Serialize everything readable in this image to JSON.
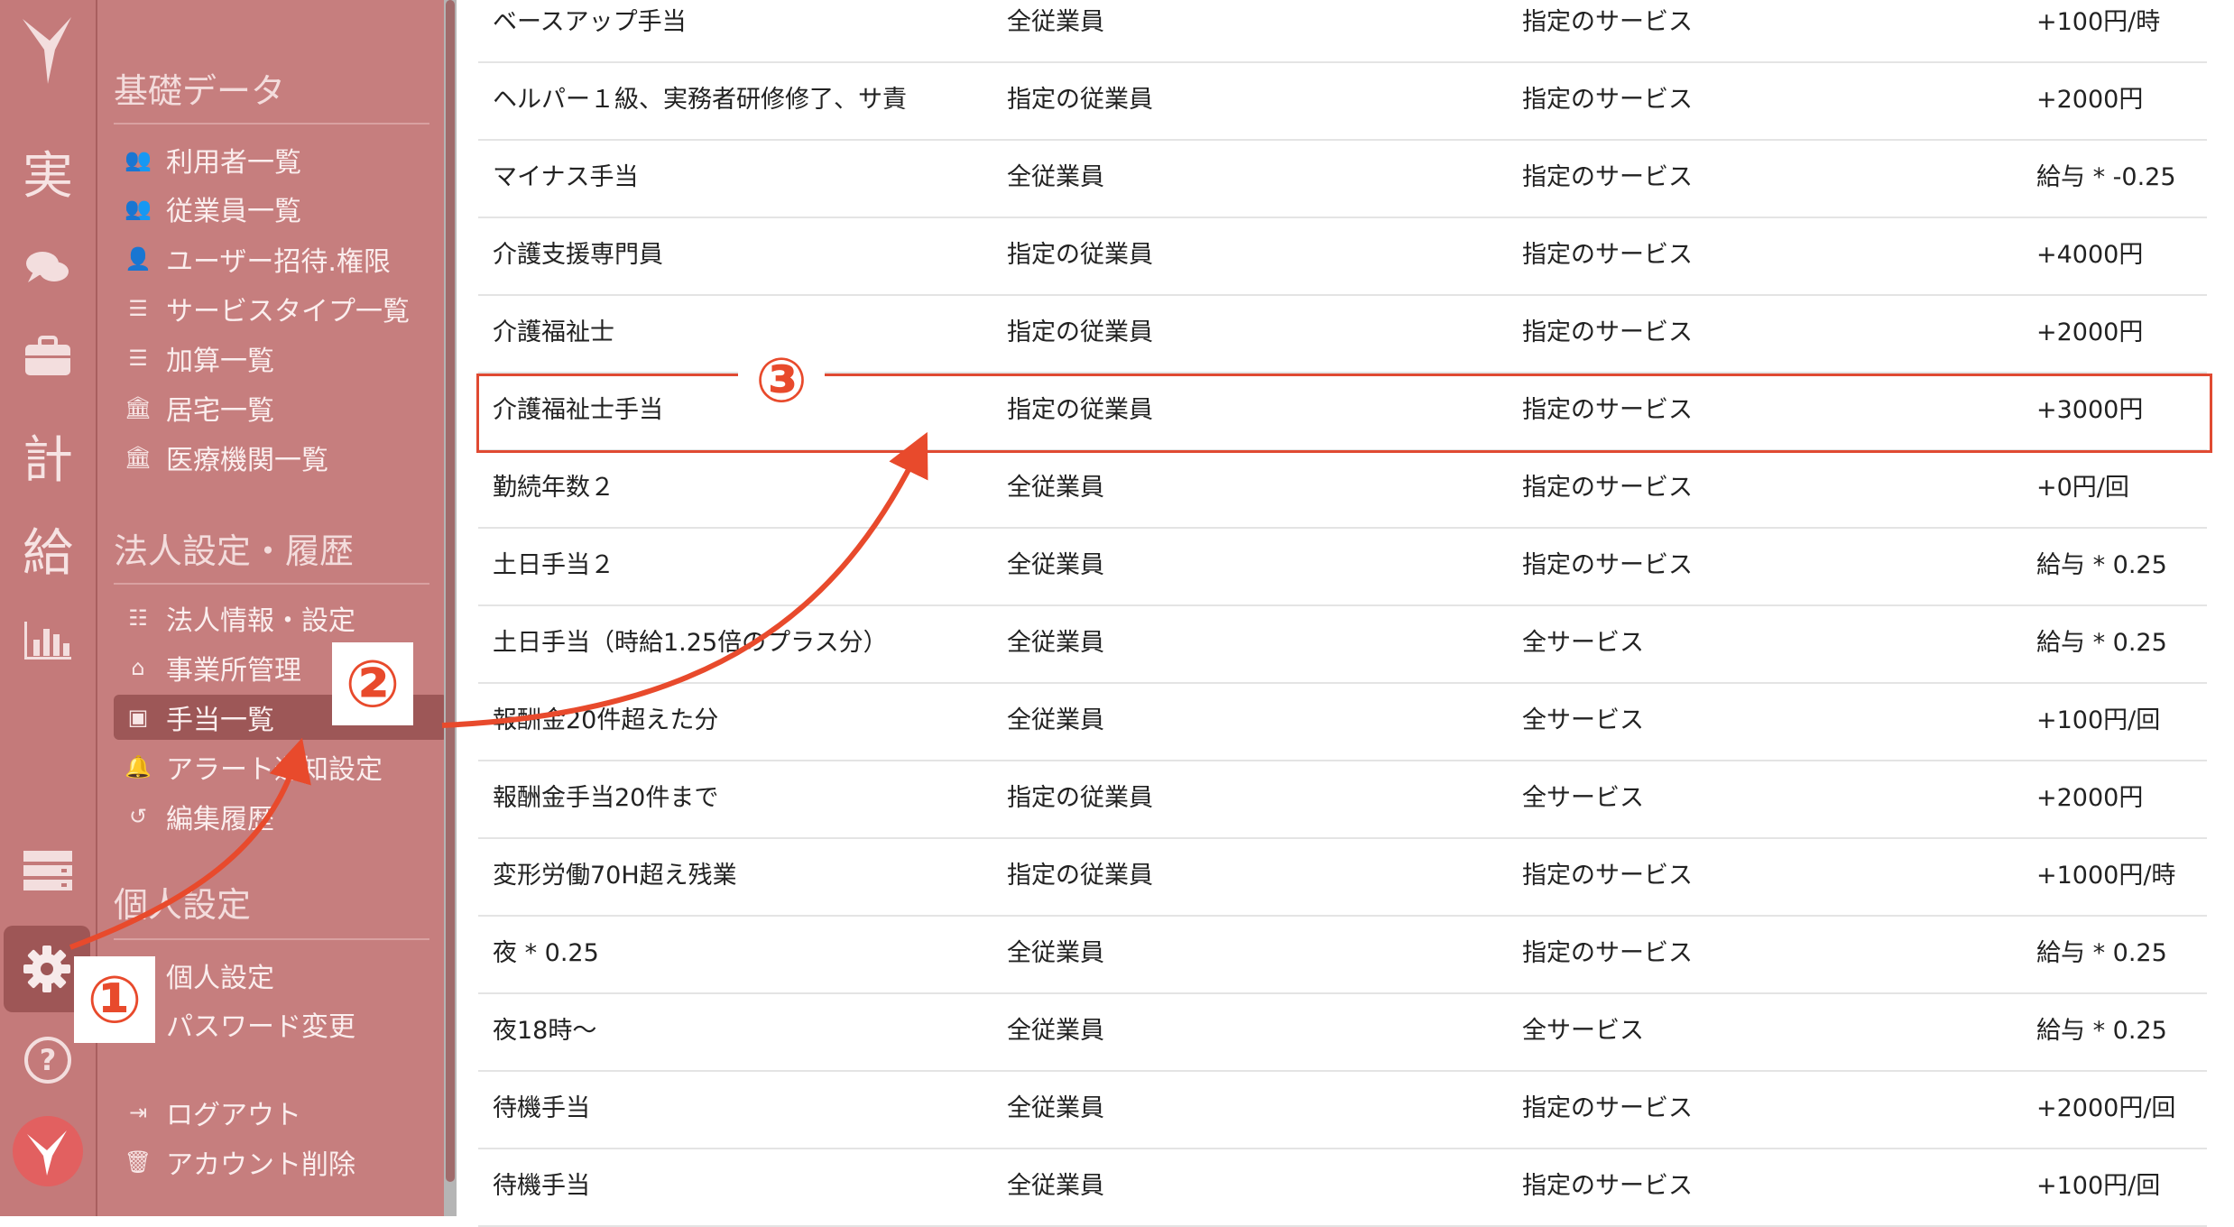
{
  "rail": {
    "items": [
      {
        "icon": "logo-icon"
      },
      {
        "label": "実"
      },
      {
        "icon": "chat-icon"
      },
      {
        "icon": "briefcase-icon"
      },
      {
        "label": "計"
      },
      {
        "label": "給"
      },
      {
        "icon": "bar-chart-icon"
      },
      {
        "icon": "server-icon"
      },
      {
        "icon": "gear-icon"
      },
      {
        "icon": "help-icon"
      },
      {
        "icon": "avatar-logo-icon"
      }
    ]
  },
  "menu": {
    "section1": {
      "title": "基礎データ",
      "items": [
        "利用者一覧",
        "従業員一覧",
        "ユーザー招待.権限",
        "サービスタイプ一覧",
        "加算一覧",
        "居宅一覧",
        "医療機関一覧"
      ]
    },
    "section2": {
      "title": "法人設定・履歴",
      "items": [
        "法人情報・設定",
        "事業所管理",
        "手当一覧",
        "アラート通知設定",
        "編集履歴"
      ]
    },
    "section3": {
      "title": "個人設定",
      "items": [
        "個人設定",
        "パスワード変更"
      ]
    },
    "footer": [
      "ログアウト",
      "アカウント削除"
    ]
  },
  "table": {
    "rows": [
      [
        "ベースアップ手当",
        "全従業員",
        "指定のサービス",
        "+100円/時"
      ],
      [
        "ヘルパー１級、実務者研修修了、サ責",
        "指定の従業員",
        "指定のサービス",
        "+2000円"
      ],
      [
        "マイナス手当",
        "全従業員",
        "指定のサービス",
        "給与 * -0.25"
      ],
      [
        "介護支援専門員",
        "指定の従業員",
        "指定のサービス",
        "+4000円"
      ],
      [
        "介護福祉士",
        "指定の従業員",
        "指定のサービス",
        "+2000円"
      ],
      [
        "介護福祉士手当",
        "指定の従業員",
        "指定のサービス",
        "+3000円"
      ],
      [
        "勤続年数２",
        "全従業員",
        "指定のサービス",
        "+0円/回"
      ],
      [
        "土日手当２",
        "全従業員",
        "指定のサービス",
        "給与 * 0.25"
      ],
      [
        "土日手当（時給1.25倍のプラス分）",
        "全従業員",
        "全サービス",
        "給与 * 0.25"
      ],
      [
        "報酬金20件超えた分",
        "全従業員",
        "全サービス",
        "+100円/回"
      ],
      [
        "報酬金手当20件まで",
        "指定の従業員",
        "全サービス",
        "+2000円"
      ],
      [
        "変形労働70H超え残業",
        "指定の従業員",
        "指定のサービス",
        "+1000円/時"
      ],
      [
        "夜 * 0.25",
        "全従業員",
        "指定のサービス",
        "給与 * 0.25"
      ],
      [
        "夜18時〜",
        "全従業員",
        "全サービス",
        "給与 * 0.25"
      ],
      [
        "待機手当",
        "全従業員",
        "指定のサービス",
        "+2000円/回"
      ],
      [
        "待機手当",
        "全従業員",
        "指定のサービス",
        "+100円/回"
      ]
    ]
  },
  "annotations": {
    "step1": "①",
    "step2": "②",
    "step3": "③",
    "color": "#e84a2c"
  }
}
